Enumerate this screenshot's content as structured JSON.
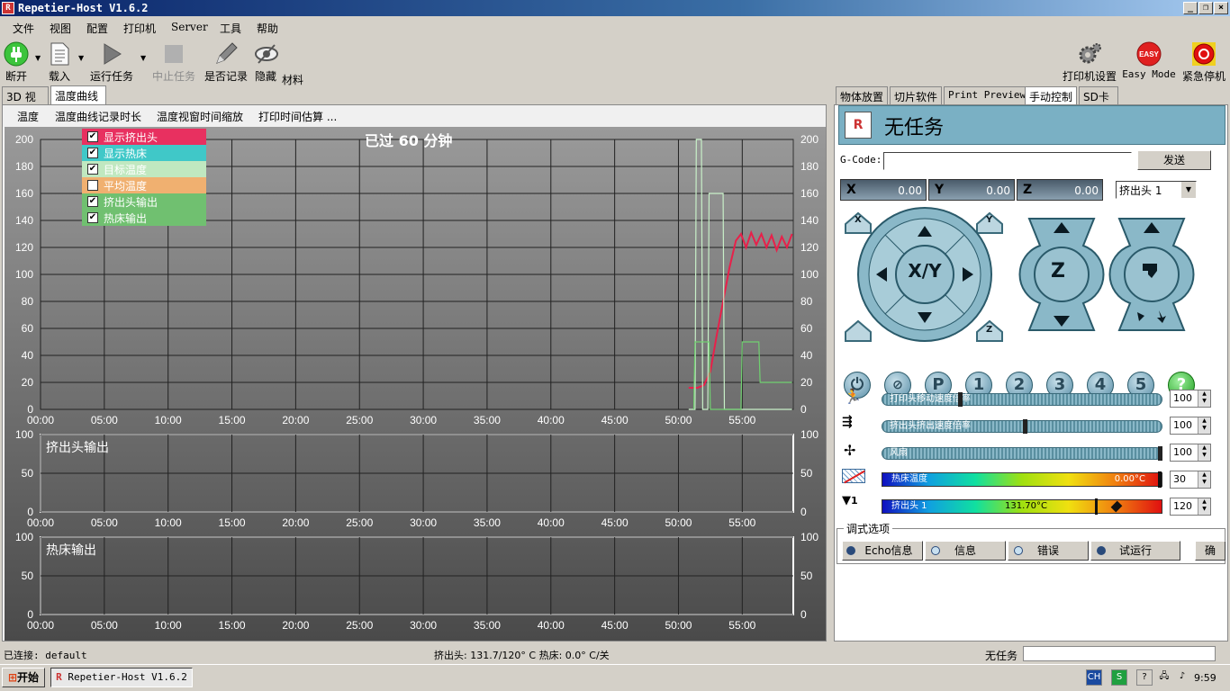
{
  "window": {
    "title": "Repetier-Host V1.6.2"
  },
  "menu": [
    "文件",
    "视图",
    "配置",
    "打印机",
    "Server",
    "工具",
    "帮助"
  ],
  "toolbar": {
    "disconnect": "断开",
    "load": "载入",
    "run": "运行任务",
    "stop": "中止任务",
    "log": "是否记录",
    "hide": "隐藏",
    "material": "材料",
    "printer_settings": "打印机设置",
    "easy_mode": "Easy Mode",
    "easy_badge": "EASY",
    "emergency": "紧急停机"
  },
  "left_tabs": [
    "3D 视窗",
    "温度曲线"
  ],
  "temp_toolbar": [
    "温度",
    "温度曲线记录时长",
    "温度视窗时间缩放",
    "打印时间估算 ..."
  ],
  "chart_data": [
    {
      "type": "line",
      "title": "已过 60 分钟",
      "x_ticks": [
        "00:00",
        "05:00",
        "10:00",
        "15:00",
        "20:00",
        "25:00",
        "30:00",
        "35:00",
        "40:00",
        "45:00",
        "50:00",
        "55:00"
      ],
      "y_ticks": [
        "0",
        "20",
        "40",
        "60",
        "80",
        "100",
        "120",
        "140",
        "160",
        "180",
        "200"
      ],
      "ylim": [
        0,
        200
      ],
      "xlim_minutes": [
        0,
        59
      ],
      "legend": [
        {
          "name": "显示挤出头",
          "checked": true,
          "color": "#e83060"
        },
        {
          "name": "显示热床",
          "checked": true,
          "color": "#40c8c8"
        },
        {
          "name": "目标温度",
          "checked": true,
          "color": "#c0e8c0"
        },
        {
          "name": "平均温度",
          "checked": false,
          "color": "#f0b070"
        },
        {
          "name": "挤出头输出",
          "checked": true,
          "color": "#70c070"
        },
        {
          "name": "热床输出",
          "checked": true,
          "color": "#70c070"
        }
      ],
      "series": [
        {
          "name": "显示挤出头",
          "color": "#e8204a",
          "x": [
            50.8,
            51.5,
            52.0,
            52.5,
            53.0,
            53.5,
            54.0,
            54.5,
            54.9,
            55.3,
            55.7,
            56.1,
            56.5,
            56.9,
            57.3,
            57.7,
            58.1,
            58.5,
            58.9
          ],
          "y": [
            16,
            16,
            18,
            28,
            55,
            80,
            105,
            125,
            130,
            120,
            131,
            122,
            130,
            120,
            129,
            118,
            128,
            120,
            130
          ]
        },
        {
          "name": "目标温度",
          "color": "#c8f0c8",
          "x": [
            50.8,
            51.3,
            51.4,
            51.8,
            51.9,
            52.3,
            52.4,
            53.5,
            53.6,
            58.9
          ],
          "y": [
            0,
            0,
            200,
            200,
            0,
            0,
            160,
            160,
            0,
            0
          ]
        },
        {
          "name": "挤出头输出",
          "color": "#70d070",
          "x": [
            51.2,
            51.3,
            52.4,
            52.5,
            54.9,
            55.0,
            56.3,
            56.4,
            58.9
          ],
          "y": [
            0,
            50,
            50,
            0,
            0,
            50,
            50,
            20,
            20
          ]
        }
      ]
    },
    {
      "type": "line",
      "title": "挤出头输出",
      "x_ticks": [
        "00:00",
        "05:00",
        "10:00",
        "15:00",
        "20:00",
        "25:00",
        "30:00",
        "35:00",
        "40:00",
        "45:00",
        "50:00",
        "55:00"
      ],
      "y_ticks": [
        "0",
        "50",
        "100"
      ],
      "ylim": [
        0,
        100
      ]
    },
    {
      "type": "line",
      "title": "热床输出",
      "x_ticks": [
        "00:00",
        "05:00",
        "10:00",
        "15:00",
        "20:00",
        "25:00",
        "30:00",
        "35:00",
        "40:00",
        "45:00",
        "50:00",
        "55:00"
      ],
      "y_ticks": [
        "0",
        "50",
        "100"
      ],
      "ylim": [
        0,
        100
      ]
    }
  ],
  "right_tabs": [
    "物体放置",
    "切片软件",
    "Print Preview",
    "手动控制",
    "SD卡"
  ],
  "manual": {
    "job_status": "无任务",
    "gcode_label": "G-Code:",
    "gcode_value": "",
    "send_button": "发送",
    "x_label": "X",
    "x_value": "0.00",
    "y_label": "Y",
    "y_value": "0.00",
    "z_label": "Z",
    "z_value": "0.00",
    "extruder_select": "挤出头 1",
    "xy_label": "X/Y",
    "z_button": "Z",
    "home_x": "X",
    "home_y": "Y",
    "home_z": "Z",
    "macro_buttons": [
      "P",
      "1",
      "2",
      "3",
      "4",
      "5",
      "?"
    ],
    "speed_label": "打印头移动速度倍率",
    "speed_value": "100",
    "flow_label": "挤出头挤出速度倍率",
    "flow_value": "100",
    "fan_label": "风扇",
    "fan_value": "100",
    "bed_label": "热床温度",
    "bed_temp": "0.00°C",
    "bed_target": "30",
    "extruder_label": "挤出头 1",
    "extruder_temp": "131.70°C",
    "extruder_target": "120",
    "extruder_index": "1",
    "debug_title": "调式选项",
    "debug_echo": "Echo信息",
    "debug_info": "信息",
    "debug_error": "错误",
    "debug_dryrun": "试运行",
    "debug_confirm": "确"
  },
  "status": {
    "connection": "已连接: default",
    "temps": "挤出头: 131.7/120° C 热床: 0.0° C/关",
    "job": "无任务"
  },
  "taskbar": {
    "start": "开始",
    "app": "Repetier-Host V1.6.2",
    "lang": "CH",
    "clock": "9:59"
  }
}
